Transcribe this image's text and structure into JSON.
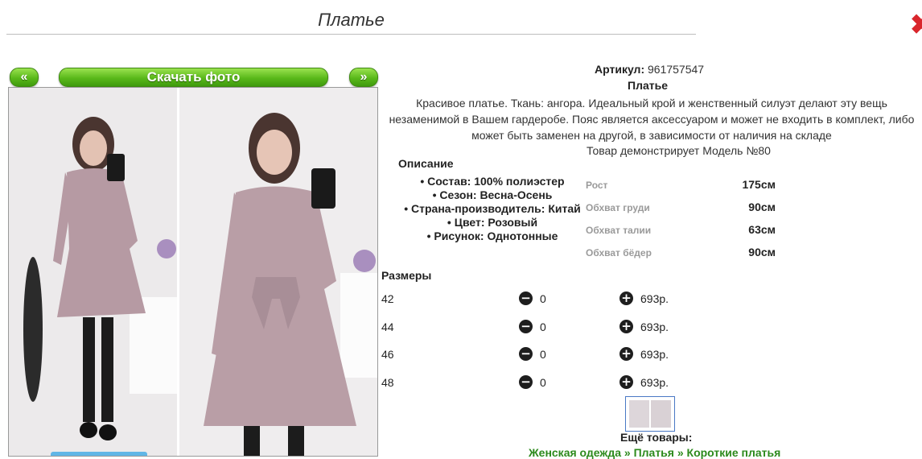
{
  "page_title": "Платье",
  "gallery": {
    "prev_label": "«",
    "download_label": "Скачать фото",
    "next_label": "»"
  },
  "product": {
    "article_label": "Артикул:",
    "article_number": "961757547",
    "name": "Платье",
    "description": "Красивое платье. Ткань: ангора. Идеальный крой и женственный силуэт делают эту вещь незаменимой в Вашем гардеробе. Пояс является аксессуаром и может не входить в комплект, либо может быть заменен на другой, в зависимости от наличия на складе",
    "model_line": "Товар демонстрирует Модель №80"
  },
  "specs": {
    "heading": "Описание",
    "items": [
      "• Состав: 100% полиэстер",
      "• Сезон: Весна-Осень",
      "• Страна-производитель: Китай",
      "• Цвет: Розовый",
      "• Рисунок: Однотонные"
    ]
  },
  "measurements": [
    {
      "label": "Рост",
      "value": "175см"
    },
    {
      "label": "Обхват груди",
      "value": "90см"
    },
    {
      "label": "Обхват талии",
      "value": "63см"
    },
    {
      "label": "Обхват бёдер",
      "value": "90см"
    }
  ],
  "sizes": {
    "heading": "Размеры",
    "rows": [
      {
        "size": "42",
        "qty": "0",
        "price": "693р."
      },
      {
        "size": "44",
        "qty": "0",
        "price": "693р."
      },
      {
        "size": "46",
        "qty": "0",
        "price": "693р."
      },
      {
        "size": "48",
        "qty": "0",
        "price": "693р."
      }
    ],
    "minus_icon": "minus-circle-icon",
    "plus_icon": "plus-circle-icon"
  },
  "more": {
    "heading": "Ещё товары:",
    "crumbs": [
      "Женская одежда",
      "Платья",
      "Короткие платья"
    ],
    "separator": " » "
  },
  "colors": {
    "accent_green": "#59b81a",
    "link_green": "#2c8a1c",
    "close_red": "#d9262c"
  }
}
